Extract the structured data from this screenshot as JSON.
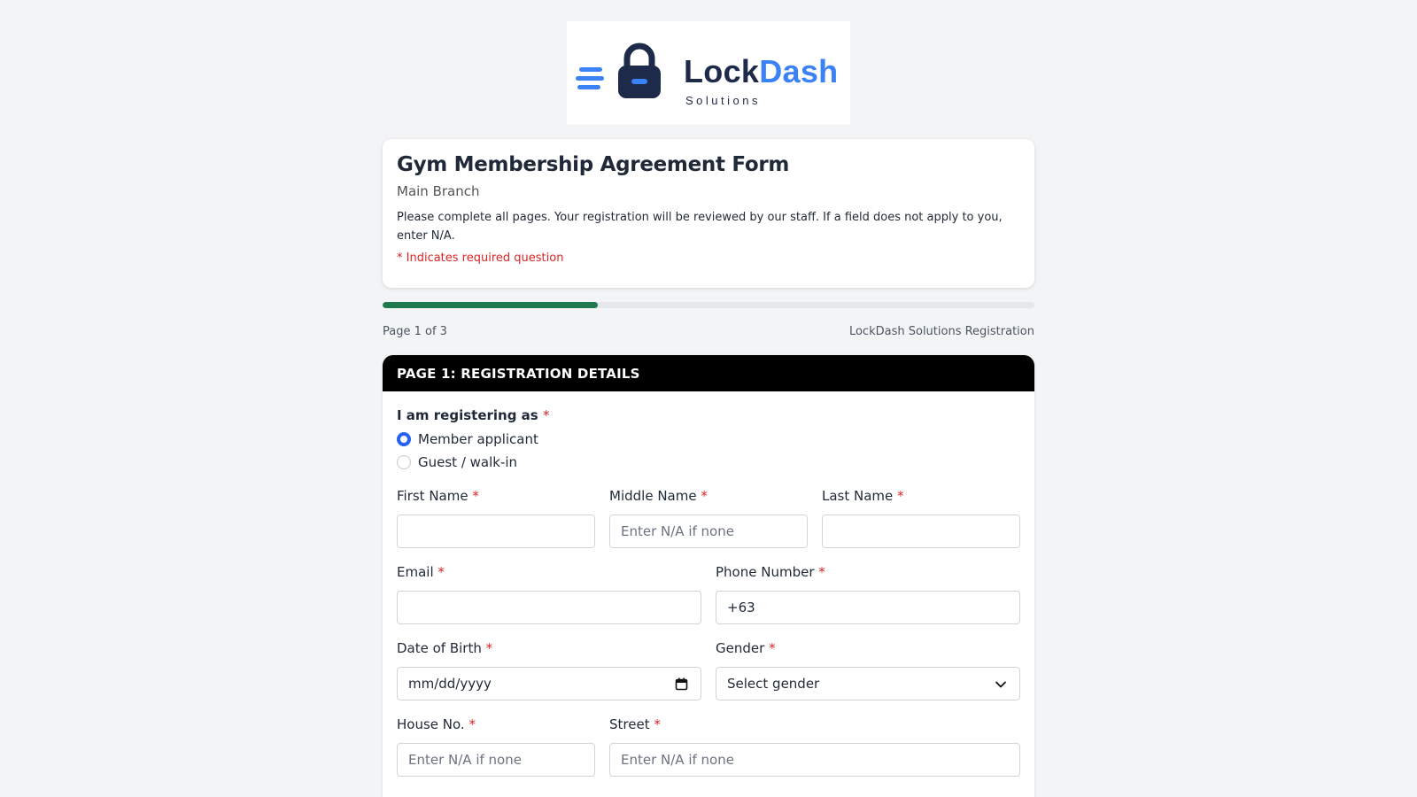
{
  "logo": {
    "word_primary": "Lock",
    "word_accent": "Dash",
    "subtitle": "Solutions",
    "colors": {
      "navy": "#1e2a4a",
      "blue": "#3b82f6"
    }
  },
  "header": {
    "title": "Gym Membership Agreement Form",
    "branch": "Main Branch",
    "description": "Please complete all pages. Your registration will be reviewed by our staff. If a field does not apply to you, enter N/A.",
    "required_note": "* Indicates required question"
  },
  "progress": {
    "fraction": 0.33,
    "page_label": "Page 1 of 3",
    "registration_label": "LockDash Solutions Registration",
    "color": "#1f7a4d"
  },
  "section": {
    "title": "PAGE 1: REGISTRATION DETAILS",
    "registering_as": {
      "label": "I am registering as",
      "options": [
        {
          "label": "Member applicant",
          "checked": true
        },
        {
          "label": "Guest / walk-in",
          "checked": false
        }
      ]
    },
    "fields": {
      "first_name": {
        "label": "First Name",
        "value": "",
        "placeholder": ""
      },
      "middle_name": {
        "label": "Middle Name",
        "value": "",
        "placeholder": "Enter N/A if none"
      },
      "last_name": {
        "label": "Last Name",
        "value": "",
        "placeholder": ""
      },
      "email": {
        "label": "Email",
        "value": "",
        "placeholder": ""
      },
      "phone": {
        "label": "Phone Number",
        "value": "+63",
        "placeholder": ""
      },
      "dob": {
        "label": "Date of Birth",
        "value": "mm/dd/yyyy"
      },
      "gender": {
        "label": "Gender",
        "value": "Select gender"
      },
      "house_no": {
        "label": "House No.",
        "placeholder": "Enter N/A if none"
      },
      "street": {
        "label": "Street",
        "placeholder": "Enter N/A if none"
      }
    },
    "required_marker": "*"
  }
}
